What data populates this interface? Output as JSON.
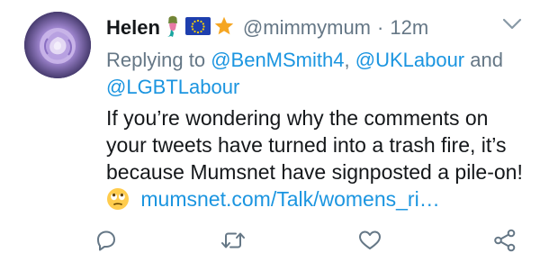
{
  "tweet": {
    "author_name": "Helen",
    "handle": "@mimmymum",
    "separator": "·",
    "time": "12m",
    "replying_prefix": "Replying to",
    "mention_1": "@BenMSmith4",
    "mention_sep": ",",
    "mention_2": "@UKLabour",
    "mention_and": "and",
    "mention_3": "@LGBTLabour",
    "text_line": "If you’re wondering why the comments on your tweets have turned into a trash fire, it’s because Mumsnet have signposted a pile-on!",
    "link_text": "mumsnet.com/Talk/womens_ri…"
  },
  "icons": {
    "name_badges": [
      "mermaid-icon",
      "eu-flag-icon",
      "star-icon"
    ],
    "inline_emoji": "face-with-rolling-eyes-icon",
    "menu": "chevron-down-icon",
    "actions": [
      "reply-icon",
      "retweet-icon",
      "like-icon",
      "share-icon"
    ]
  },
  "colors": {
    "text": "#14171a",
    "muted": "#657786",
    "accent": "#1b95e0",
    "star": "#f5a623",
    "eu_blue": "#1e3fae"
  }
}
